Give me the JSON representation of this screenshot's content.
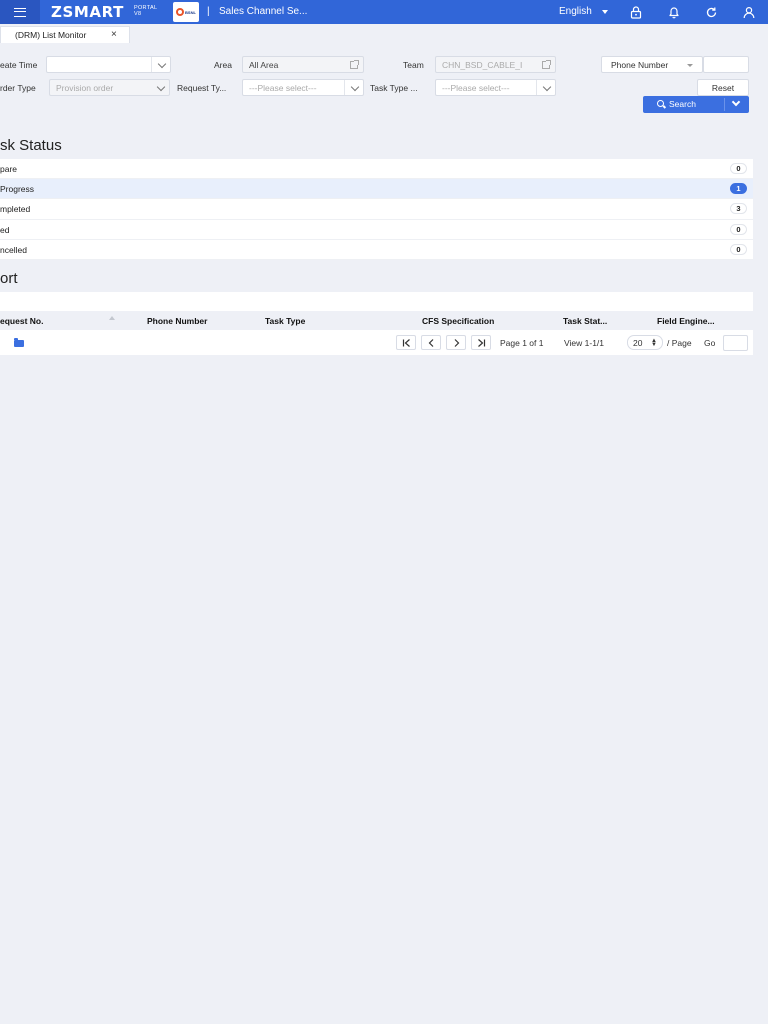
{
  "topbar": {
    "brand": "ZSMART",
    "brand_sub_1": "PORTAL",
    "brand_sub_2": "V8",
    "separator": "|",
    "app_title": "Sales Channel Se...",
    "language": "English"
  },
  "tabs": [
    {
      "label": "(DRM) List Monitor",
      "close": "×"
    }
  ],
  "filters": {
    "create_time_label": "eate Time",
    "create_time_value": "",
    "area_label": "Area",
    "area_value": "All Area",
    "team_label": "Team",
    "team_value": "CHN_BSD_CABLE_I",
    "phone_select": "Phone Number",
    "phone_value": "",
    "order_type_label": "rder Type",
    "order_type_value": "Provision order",
    "request_type_label": "Request Ty...",
    "request_type_placeholder": "---Please select---",
    "task_type_label": "Task Type ...",
    "task_type_placeholder": "---Please select---",
    "reset_label": "Reset",
    "search_label": "Search"
  },
  "task_status": {
    "title": "sk Status",
    "items": [
      {
        "label": "pare",
        "count": "0"
      },
      {
        "label": "Progress",
        "count": "1"
      },
      {
        "label": "mpleted",
        "count": "3"
      },
      {
        "label": "ed",
        "count": "0"
      },
      {
        "label": "ncelled",
        "count": "0"
      }
    ]
  },
  "report": {
    "title": "ort",
    "columns": [
      "equest No.",
      "Phone Number",
      "Task Type",
      "CFS Specification",
      "Task Stat...",
      "Field Engine..."
    ],
    "pagination": {
      "first": "K",
      "prev": "<",
      "next": ">",
      "last": ">|",
      "page_text": "Page 1 of 1",
      "view_text": "View 1-1/1",
      "page_size": "20",
      "per_page": "/ Page",
      "go": "Go"
    }
  },
  "colors": {
    "topbar": "#3166d8",
    "accent": "#3b6fe0",
    "background": "#eef0f6"
  }
}
